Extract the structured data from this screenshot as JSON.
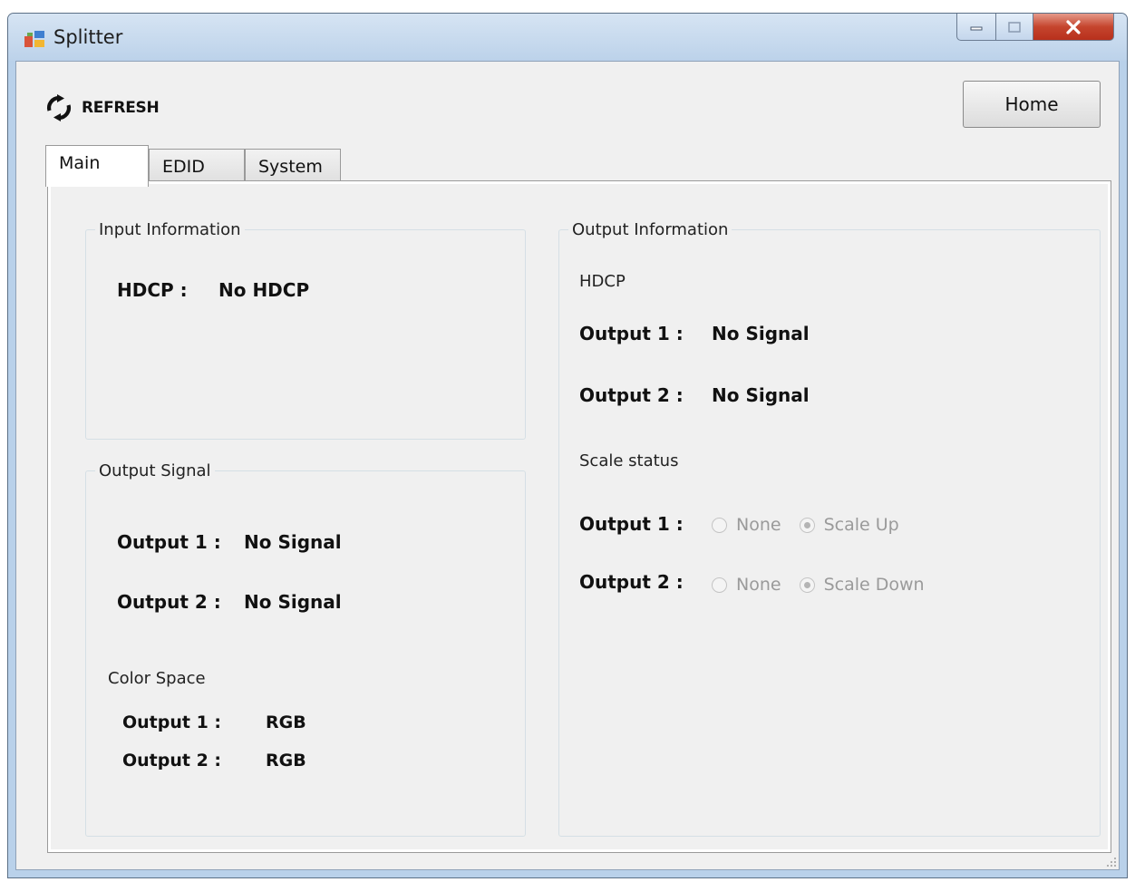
{
  "window": {
    "title": "Splitter"
  },
  "toolbar": {
    "refresh_label": "REFRESH",
    "home_label": "Home"
  },
  "tabs": [
    {
      "label": "Main",
      "selected": true
    },
    {
      "label": "EDID",
      "selected": false
    },
    {
      "label": "System",
      "selected": false
    }
  ],
  "input_info": {
    "title": "Input Information",
    "hdcp_label": "HDCP :",
    "hdcp_value": "No HDCP"
  },
  "output_signal": {
    "title": "Output Signal",
    "rows": [
      {
        "label": "Output 1 :",
        "value": "No Signal"
      },
      {
        "label": "Output 2 :",
        "value": "No Signal"
      }
    ],
    "color_space": {
      "title": "Color Space",
      "rows": [
        {
          "label": "Output 1 :",
          "value": "RGB"
        },
        {
          "label": "Output 2 :",
          "value": "RGB"
        }
      ]
    }
  },
  "output_info": {
    "title": "Output Information",
    "hdcp_title": "HDCP",
    "hdcp_rows": [
      {
        "label": "Output 1 :",
        "value": "No Signal"
      },
      {
        "label": "Output 2 :",
        "value": "No Signal"
      }
    ],
    "scale_title": "Scale status",
    "scale_rows": [
      {
        "label": "Output 1 :",
        "option_none": "None",
        "option_scale": "Scale Up",
        "selected": "Scale Up"
      },
      {
        "label": "Output 2 :",
        "option_none": "None",
        "option_scale": "Scale Down",
        "selected": "Scale Down"
      }
    ]
  },
  "icons": {
    "app": "splitter-app-icon",
    "refresh": "refresh-icon",
    "minimize": "minimize-icon",
    "maximize": "maximize-icon",
    "close": "close-icon"
  },
  "colors": {
    "close_button": "#c5452e",
    "title_bar": "#c8dcf0"
  }
}
